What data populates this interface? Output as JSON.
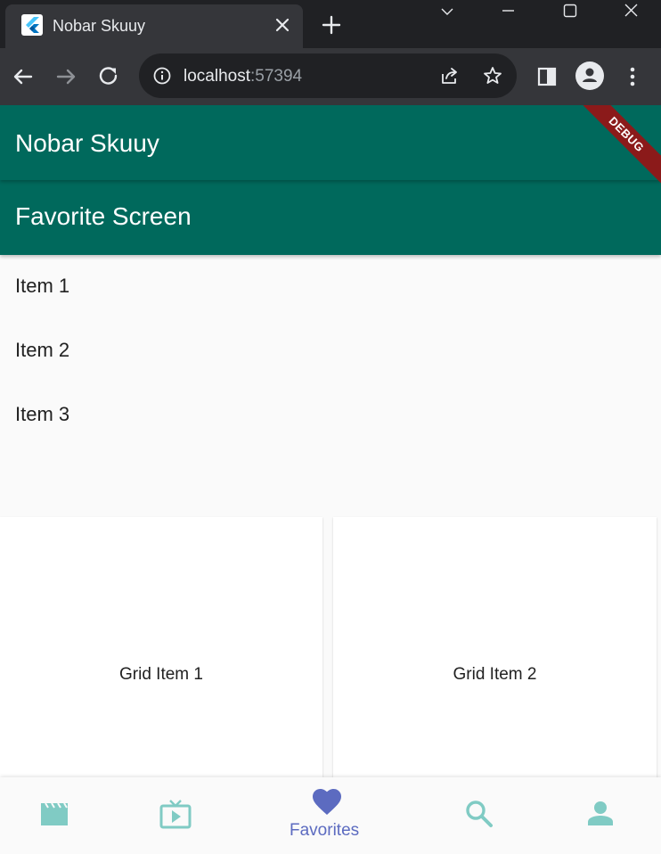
{
  "browser": {
    "tab_title": "Nobar Skuuy",
    "url_host": "localhost",
    "url_port": ":57394"
  },
  "app": {
    "title": "Nobar Skuuy",
    "screen_title": "Favorite Screen",
    "debug_label": "DEBUG",
    "list_items": [
      {
        "label": "Item 1"
      },
      {
        "label": "Item 2"
      },
      {
        "label": "Item 3"
      }
    ],
    "grid_items": [
      {
        "label": "Grid Item 1"
      },
      {
        "label": "Grid Item 2"
      }
    ],
    "bottom_nav": {
      "selected": "favorites",
      "favorites_label": "Favorites",
      "items": [
        {
          "id": "movies",
          "icon": "movie-icon"
        },
        {
          "id": "tv",
          "icon": "live-tv-icon"
        },
        {
          "id": "favorites",
          "icon": "favorite-icon"
        },
        {
          "id": "search",
          "icon": "search-icon"
        },
        {
          "id": "profile",
          "icon": "person-icon"
        }
      ]
    },
    "colors": {
      "appbar": "#00695c",
      "nav_inactive": "#80cbc4",
      "nav_active": "#5c6bc0",
      "debug_banner": "#8b1a1a"
    }
  }
}
